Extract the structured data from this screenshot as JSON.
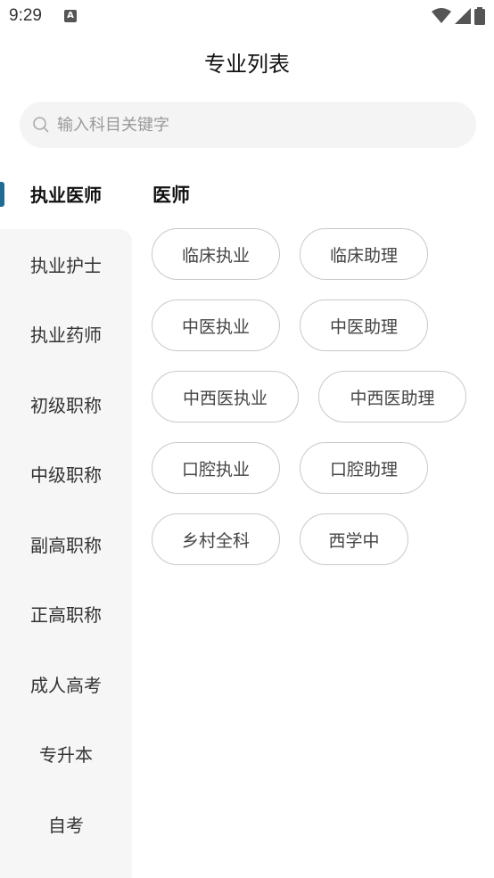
{
  "status_bar": {
    "time": "9:29",
    "notification_badge": "A"
  },
  "page": {
    "title": "专业列表"
  },
  "search": {
    "placeholder": "输入科目关键字"
  },
  "sidebar": {
    "items": [
      {
        "label": "执业医师",
        "active": true
      },
      {
        "label": "执业护士"
      },
      {
        "label": "执业药师"
      },
      {
        "label": "初级职称"
      },
      {
        "label": "中级职称"
      },
      {
        "label": "副高职称"
      },
      {
        "label": "正高职称"
      },
      {
        "label": "成人高考"
      },
      {
        "label": "专升本"
      },
      {
        "label": "自考"
      }
    ]
  },
  "content": {
    "section_title": "医师",
    "chips": [
      {
        "label": "临床执业"
      },
      {
        "label": "临床助理"
      },
      {
        "label": "中医执业"
      },
      {
        "label": "中医助理"
      },
      {
        "label": "中西医执业"
      },
      {
        "label": "中西医助理"
      },
      {
        "label": "口腔执业"
      },
      {
        "label": "口腔助理"
      },
      {
        "label": "乡村全科"
      },
      {
        "label": "西学中"
      }
    ]
  },
  "colors": {
    "accent": "#1e6c95",
    "sidebar_bg": "#f6f6f6",
    "search_bg": "#f4f4f4",
    "chip_border": "#c9c9c9"
  }
}
